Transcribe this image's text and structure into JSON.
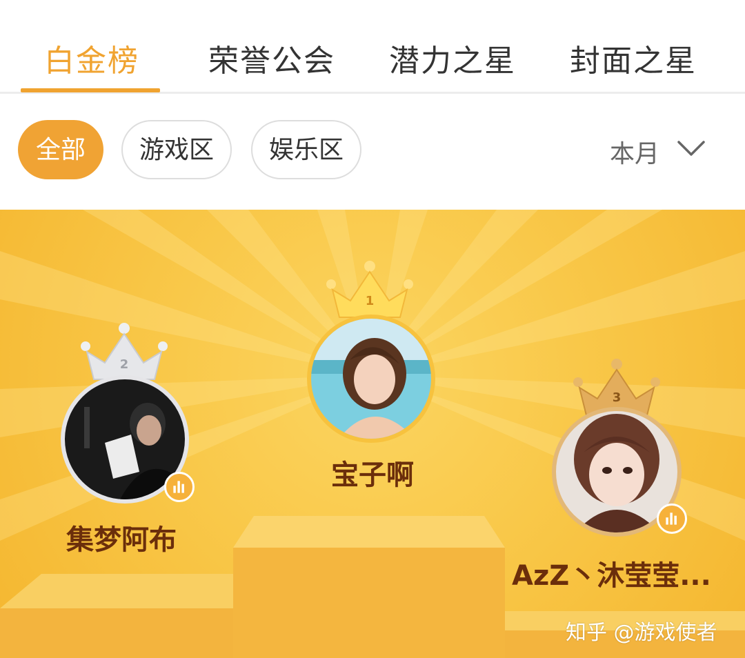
{
  "tabs": [
    {
      "label": "白金榜",
      "active": true
    },
    {
      "label": "荣誉公会",
      "active": false
    },
    {
      "label": "潜力之星",
      "active": false
    },
    {
      "label": "封面之星",
      "active": false
    }
  ],
  "filters": {
    "chips": [
      {
        "label": "全部",
        "active": true
      },
      {
        "label": "游戏区",
        "active": false
      },
      {
        "label": "娱乐区",
        "active": false
      }
    ],
    "period": {
      "label": "本月",
      "icon": "chevron-down-icon"
    }
  },
  "podium": {
    "rank1": {
      "rank": "1",
      "name": "宝子啊",
      "crown": "gold-crown-icon"
    },
    "rank2": {
      "rank": "2",
      "name": "集梦阿布",
      "crown": "silver-crown-icon",
      "badge": "live-bars-icon"
    },
    "rank3": {
      "rank": "3",
      "name": "AzZ丶沐莹莹...",
      "crown": "bronze-crown-icon",
      "badge": "live-bars-icon"
    }
  },
  "watermark": "知乎 @游戏使者",
  "colors": {
    "accent": "#f0a330",
    "podium_bg": "#f8c544",
    "name_text": "#6b2e0b",
    "silver": "#d7d8dc",
    "bronze": "#d9a24c"
  }
}
